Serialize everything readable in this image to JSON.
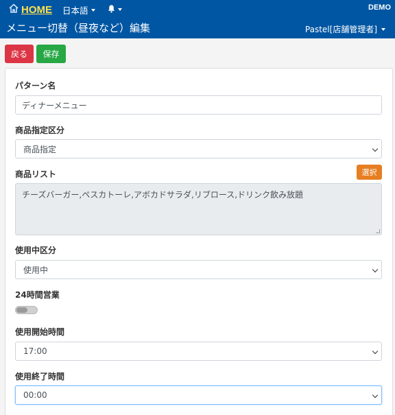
{
  "header": {
    "home_label": "HOME",
    "language_label": "日本語",
    "demo_label": "DEMO",
    "page_title": "メニュー切替（昼夜など）編集",
    "user_label": "Pastel[店舗管理者]"
  },
  "actions": {
    "back_label": "戻る",
    "save_label": "保存"
  },
  "form": {
    "pattern_name": {
      "label": "パターン名",
      "value": "ディナーメニュー"
    },
    "product_spec": {
      "label": "商品指定区分",
      "value": "商品指定"
    },
    "product_list": {
      "label": "商品リスト",
      "select_button": "選択",
      "value": "チーズバーガー,ペスカトーレ,アボカドサラダ,リブロース,ドリンク飲み放題"
    },
    "usage_status": {
      "label": "使用中区分",
      "value": "使用中"
    },
    "open_24h": {
      "label": "24時間営業",
      "on": false
    },
    "start_time": {
      "label": "使用開始時間",
      "value": "17:00"
    },
    "end_time": {
      "label": "使用終了時間",
      "value": "00:00"
    }
  }
}
